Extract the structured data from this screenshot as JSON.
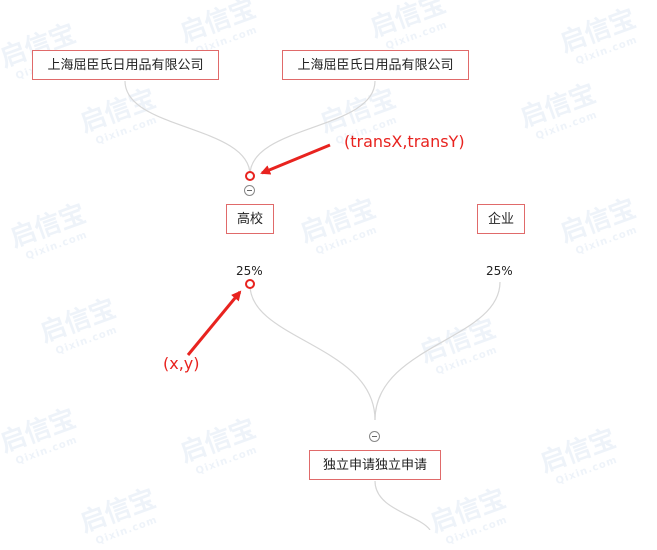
{
  "watermark": {
    "brand": "启信宝",
    "domain": "Qixin.com"
  },
  "nodes": {
    "shareholder_1": "上海屈臣氏日用品有限公司",
    "shareholder_2": "上海屈臣氏日用品有限公司",
    "school": "高校",
    "enterprise": "企业",
    "target": "独立申请独立申请"
  },
  "percentages": {
    "school_share": "25%",
    "enterprise_share": "25%"
  },
  "annotations": {
    "trans_label": "(transX,transY)",
    "xy_label": "(x,y)",
    "color": "#e8231f"
  }
}
